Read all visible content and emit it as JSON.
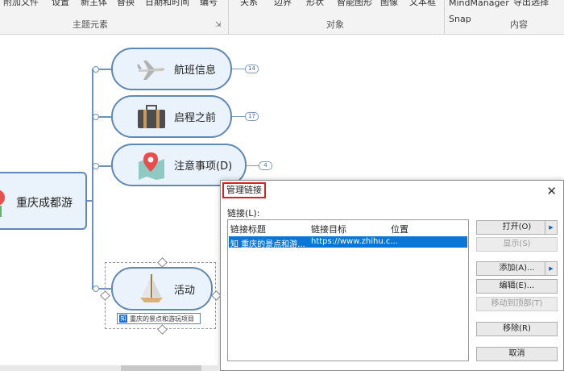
{
  "ribbon": {
    "top_items": [
      "附加文件",
      "设置",
      "新主体",
      "替换",
      "日期和时间",
      "编号",
      "关系",
      "边界",
      "形状",
      "智能图形",
      "图像",
      "文本框",
      "MindManager Snap",
      "导出选择"
    ],
    "groups": [
      "主题元素",
      "对象",
      "内容"
    ]
  },
  "map": {
    "central_topic": "重庆成都游",
    "topics": [
      {
        "label": "航班信息",
        "count": "14",
        "icon": "airplane-icon"
      },
      {
        "label": "启程之前",
        "count": "17",
        "icon": "briefcase-icon"
      },
      {
        "label": "注意事项(D)",
        "count": "4",
        "icon": "map-pin-icon"
      },
      {
        "label": "活动",
        "icon": "sailboat-icon"
      }
    ],
    "link_tag": "重庆的景点和游玩项目",
    "link_tag_prefix": "知"
  },
  "dialog": {
    "title": "管理链接",
    "links_label": "链接(L):",
    "columns": [
      "链接标题",
      "链接目标",
      "位置"
    ],
    "rows": [
      {
        "title": "知 重庆的景点和游...",
        "target": "https://www.zhihu.c...",
        "position": ""
      }
    ],
    "buttons": {
      "open": "打开(O)",
      "show": "显示(S)",
      "add": "添加(A)...",
      "edit": "编辑(E)...",
      "move_top": "移动到顶部(T)",
      "remove": "移除(R)",
      "cancel": "取消"
    }
  },
  "colors": {
    "topic_border": "#5f88b3",
    "topic_fill": "#eaf2fb",
    "selection": "#0a76d8",
    "title_highlight": "#d9221f"
  }
}
